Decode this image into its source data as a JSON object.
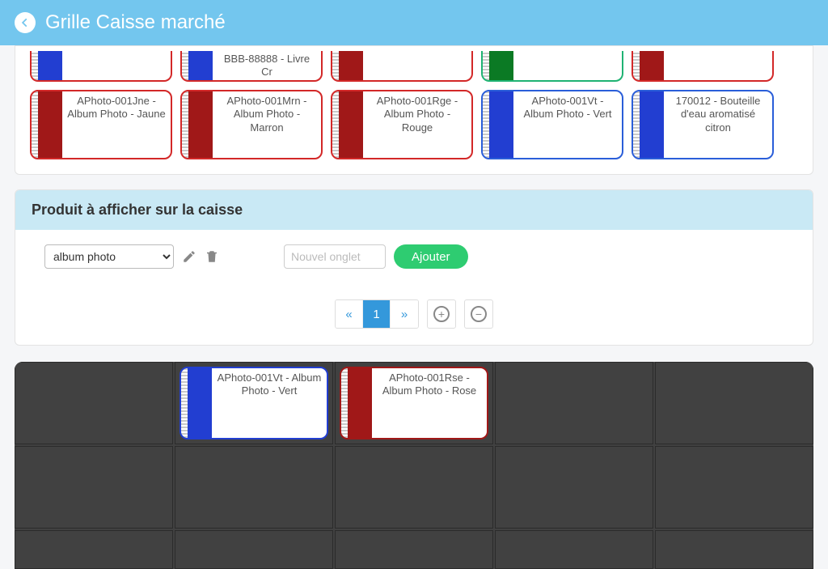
{
  "header": {
    "title": "Grille Caisse marché"
  },
  "partialRow": [
    {
      "border": "#d32828",
      "swatch": "#223ed1",
      "label": ""
    },
    {
      "border": "#d32828",
      "swatch": "#223ed1",
      "label": "BBB-88888 - Livre Cr"
    },
    {
      "border": "#d32828",
      "swatch": "#a01818",
      "label": ""
    },
    {
      "border": "#1fb373",
      "swatch": "#0b7a24",
      "label": ""
    },
    {
      "border": "#d32828",
      "swatch": "#a01818",
      "label": ""
    }
  ],
  "row2": [
    {
      "border": "#d32828",
      "swatch": "#a01818",
      "label": "APhoto-001Jne - Album Photo - Jaune"
    },
    {
      "border": "#d32828",
      "swatch": "#a01818",
      "label": "APhoto-001Mrn - Album Photo - Marron"
    },
    {
      "border": "#d32828",
      "swatch": "#a01818",
      "label": "APhoto-001Rge - Album Photo - Rouge"
    },
    {
      "border": "#2a5ed9",
      "swatch": "#223ed1",
      "label": "APhoto-001Vt - Album Photo - Vert"
    },
    {
      "border": "#2a5ed9",
      "swatch": "#223ed1",
      "label": "170012 - Bouteille d'eau aromatisé citron"
    }
  ],
  "panel": {
    "title": "Produit à afficher sur la caisse",
    "selectValue": "album photo",
    "newTabPlaceholder": "Nouvel onglet",
    "addLabel": "Ajouter",
    "page": "1"
  },
  "gridRow1": [
    null,
    {
      "border": "#223ed1",
      "swatch": "#223ed1",
      "label": "APhoto-001Vt - Album Photo - Vert"
    },
    {
      "border": "#a01818",
      "swatch": "#a01818",
      "label": "APhoto-001Rse - Album Photo - Rose"
    },
    null,
    null
  ]
}
